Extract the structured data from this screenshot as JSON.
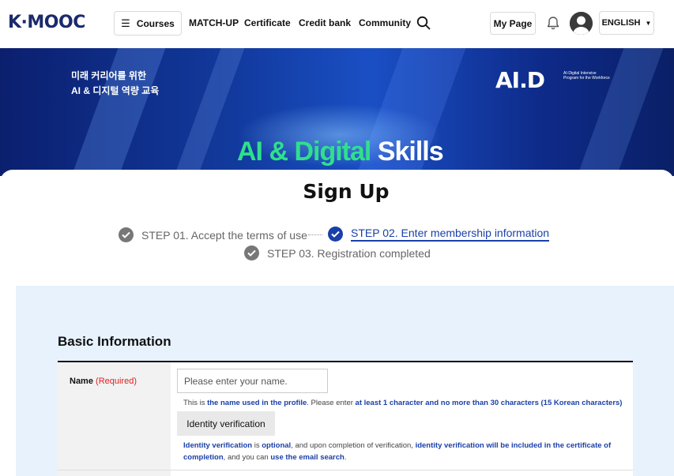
{
  "header": {
    "logo": "K·MOOC",
    "courses_label": "Courses",
    "nav": [
      "MATCH-UP",
      "Certificate",
      "Credit bank",
      "Community"
    ],
    "mypage_label": "My Page",
    "language": "ENGLISH"
  },
  "banner": {
    "ko_line1": "미래 커리어를 위한",
    "ko_line2": "AI & 디지털 역량 교육",
    "aid_logo": "AI.D",
    "aid_sub": "AI·Digital Intensive Program for the Workforce",
    "title_green": "AI & Digital",
    "title_white": "Skills"
  },
  "signup": {
    "title": "Sign Up",
    "steps": [
      {
        "label": "STEP 01. Accept the terms of use",
        "state": "done"
      },
      {
        "label": "STEP 02. Enter membership information",
        "state": "active"
      },
      {
        "label": "STEP 03. Registration completed",
        "state": "pending"
      }
    ]
  },
  "form": {
    "section_title": "Basic Information",
    "name_label": "Name",
    "name_required": "(Required)",
    "name_placeholder": "Please enter your name.",
    "help1_a": "This is ",
    "help1_b": "the name used in the profile",
    "help1_c": ". Please enter ",
    "help1_d": "at least 1 character and no more than 30 characters (15 Korean characters)",
    "identity_button": "Identity verification",
    "help2_a": "Identity verification",
    "help2_b": " is ",
    "help2_c": "optional",
    "help2_d": ", and upon completion of verification, ",
    "help2_e": "identity verification will be included in the certificate of completion",
    "help2_f": ", and you can ",
    "help2_g": "use the email search",
    "help2_h": "."
  },
  "colors": {
    "accent": "#1a3fa8",
    "required": "#e02020",
    "form_bg": "#e8f2fd",
    "banner_green": "#2fe08a"
  }
}
